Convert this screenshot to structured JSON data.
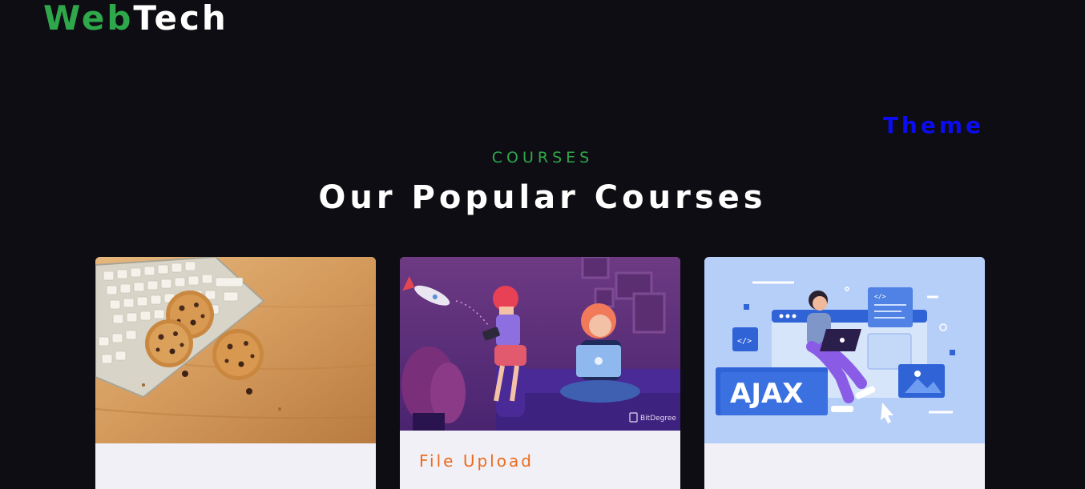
{
  "brand": {
    "part1": "Web",
    "part2": "Tech"
  },
  "theme_toggle": {
    "label": "Theme"
  },
  "courses_section": {
    "tag": "COURSES",
    "heading": "Our Popular Courses",
    "cards": [
      {
        "image": "cookies-keyboard-image",
        "title": ""
      },
      {
        "image": "file-upload-illustration",
        "title": "File Upload",
        "image_watermark": "BitDegree"
      },
      {
        "image": "ajax-illustration",
        "title": "",
        "image_text": "AJAX"
      }
    ]
  },
  "colors": {
    "background": "#0e0d13",
    "brand_green": "#2ea84a",
    "theme_blue": "#0c0cf0",
    "card_title_orange": "#ec6a1c",
    "card_background": "#f1f0f6"
  }
}
